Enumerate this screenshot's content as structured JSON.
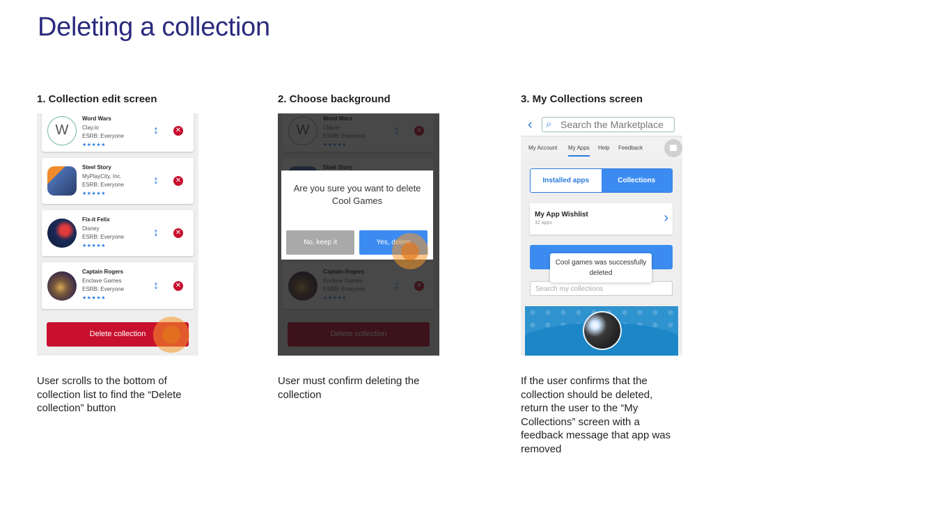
{
  "page": {
    "title": "Deleting a collection"
  },
  "steps": [
    {
      "heading": "1. Collection edit screen",
      "caption": "User scrolls to the bottom of collection list to find the “Delete collection” button"
    },
    {
      "heading": "2. Choose background",
      "caption": "User must confirm deleting the collection"
    },
    {
      "heading": "3. My Collections screen",
      "caption": "If the user confirms that the collection should be deleted, return the user to the “My Collections” screen with a feedback message that app was removed"
    }
  ],
  "apps": [
    {
      "name": "Word Wars",
      "publisher": "Clay.io",
      "rating": "ESRB: Everyone",
      "stars": "★★★★★",
      "initial": "W"
    },
    {
      "name": "Steel Story",
      "publisher": "MyPlayCity, Inc.",
      "rating": "ESRB: Everyone",
      "stars": "★★★★★"
    },
    {
      "name": "Fix-it Felix",
      "publisher": "Disney",
      "rating": "ESRB: Everyone",
      "stars": "★★★★★"
    },
    {
      "name": "Captain Rogers",
      "publisher": "Enclave Games",
      "rating": "ESRB: Everyone",
      "stars": "★★★★★"
    }
  ],
  "icons": {
    "reorder": "↕",
    "remove": "✕",
    "back": "‹",
    "search": "⌕",
    "chevron": "›"
  },
  "delete_collection_label": "Delete collection",
  "confirm_dialog": {
    "message": "Are you sure you want to delete Cool Games",
    "cancel_label": "No, keep it",
    "confirm_label": "Yes, delete"
  },
  "marketplace": {
    "search_placeholder": "Search the Marketplace",
    "nav": [
      "My Account",
      "My Apps",
      "Help",
      "Feedback"
    ],
    "tabs": {
      "installed": "Installed apps",
      "collections": "Collections"
    },
    "wishlist": {
      "title": "My App Wishlist",
      "count": "32 apps"
    },
    "toast": "Cool games was successfully deleted",
    "collections_search_placeholder": "Search my collections"
  },
  "colors": {
    "title": "#2a2a7e",
    "accent_blue": "#3b8bf0",
    "delete_red": "#c8102e",
    "touch_orange": "#f7982a"
  }
}
